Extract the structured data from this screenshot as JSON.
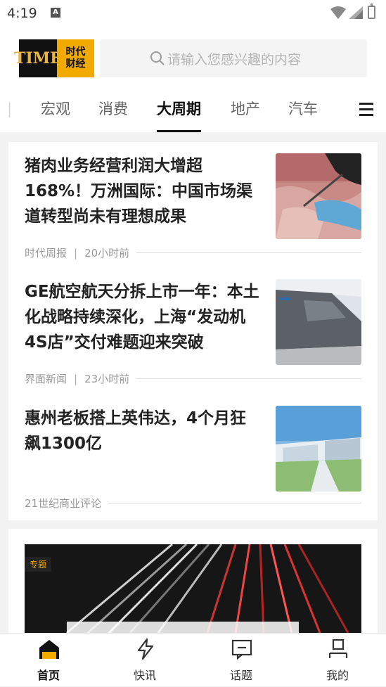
{
  "status_bar": {
    "time": "4:19"
  },
  "header": {
    "logo_text_left": "TIME",
    "logo_text_right_1": "时代",
    "logo_text_right_2": "财经",
    "search_placeholder": "请输入您感兴趣的内容"
  },
  "tabs": [
    {
      "label": "宏观",
      "active": false
    },
    {
      "label": "消费",
      "active": false
    },
    {
      "label": "大周期",
      "active": true
    },
    {
      "label": "地产",
      "active": false
    },
    {
      "label": "汽车",
      "active": false
    }
  ],
  "articles": [
    {
      "title": "猪肉业务经营利润大增超168%！万洲国际：中国市场渠道转型尚未有理想成果",
      "source": "时代周报",
      "time": "20小时前",
      "image": "meat-processing-photo"
    },
    {
      "title": "GE航空航天分拆上市一年：本土化战略持续深化，上海“发动机4S店”交付难题迎来突破",
      "source": "界面新闻",
      "time": "23小时前",
      "image": "factory-building-photo"
    },
    {
      "title": "惠州老板搭上英伟达，4个月狂飙1300亿",
      "source": "21世纪商业评论",
      "time": "",
      "image": "industrial-park-photo"
    }
  ],
  "banner": {
    "tag": "专题"
  },
  "bottom_nav": [
    {
      "label": "首页",
      "icon": "home-icon",
      "active": true
    },
    {
      "label": "快讯",
      "icon": "lightning-icon",
      "active": false
    },
    {
      "label": "话题",
      "icon": "topic-icon",
      "active": false
    },
    {
      "label": "我的",
      "icon": "profile-icon",
      "active": false
    }
  ],
  "colors": {
    "accent": "#f2a900",
    "text": "#222222",
    "muted": "#999999"
  }
}
